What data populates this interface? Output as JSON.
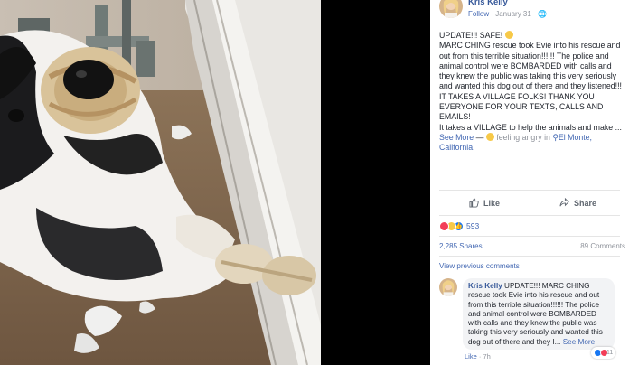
{
  "post": {
    "author": "Kris Kelly",
    "follow_label": "Follow",
    "separator": " · ",
    "date": "January 31",
    "text": "UPDATE!!! SAFE! ",
    "text_line2": "MARC CHING rescue took Evie into his rescue and out from this terrible situation!!!!!! The police and animal control were BOMBARDED with calls and they knew the public was taking this very seriously and wanted this dog out of there and they listened!!! IT TAKES A VILLAGE FOLKS! THANK YOU EVERYONE FOR YOUR TEXTS, CALLS AND EMAILS!",
    "text_line3": "It takes a VILLAGE to help the animals and make ...",
    "see_more": "See More",
    "dash": " — ",
    "feeling": " feeling angry in ",
    "location": "El Monte, California",
    "trailing_period": "."
  },
  "actions": {
    "like": "Like",
    "share": "Share"
  },
  "stats": {
    "reactions_count": "593",
    "shares": "2,285 Shares",
    "comments": "89 Comments",
    "view_previous": "View previous comments"
  },
  "comment": {
    "author": "Kris Kelly",
    "text": " UPDATE!!! MARC CHING rescue took Evie into his rescue and out from this terrible situation!!!!!! The police and animal control were BOMBARDED with calls and they knew the public was taking this very seriously and wanted this dog out of there and they I...",
    "see_more": "See More",
    "reaction_count": "11",
    "like": "Like",
    "separator": " · ",
    "time": "7h"
  },
  "colors": {
    "link": "#365899",
    "accent": "#4267b2",
    "like_blue": "#1877f2",
    "love_red": "#f33e58",
    "angry_orange": "#e9710f",
    "wow_yellow": "#f7c948"
  },
  "icons": {
    "feeling": "angry-emoji-icon",
    "location": "location-pin-icon",
    "like": "thumbs-up-icon",
    "share": "share-arrow-icon",
    "globe": "globe-icon"
  }
}
